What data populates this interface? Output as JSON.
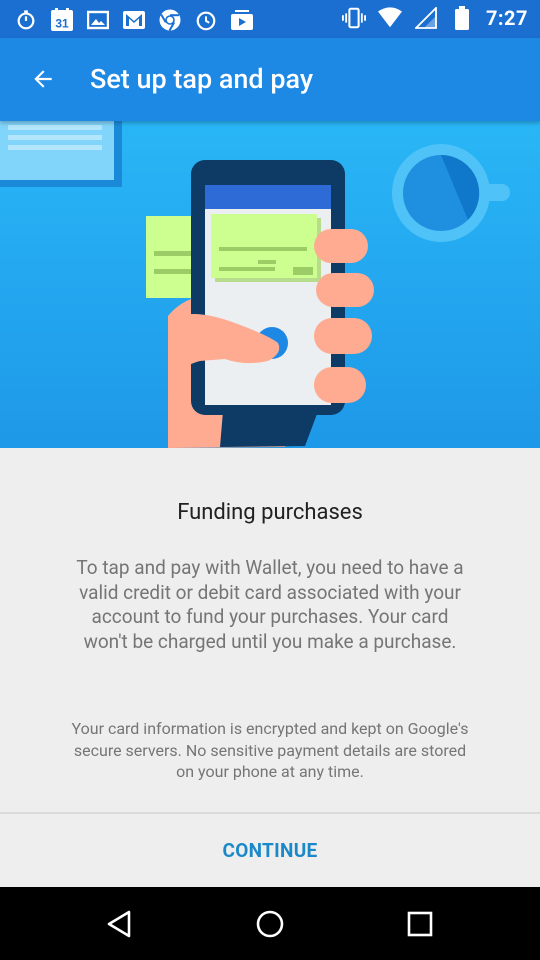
{
  "status_bar": {
    "time": "7:27",
    "calendar_date": "31",
    "left_icons": [
      "stopwatch-icon",
      "calendar-icon",
      "image-icon",
      "gmail-icon",
      "chrome-icon",
      "alarm-icon",
      "photos-icon"
    ],
    "right_icons": [
      "vibrate-icon",
      "wifi-icon",
      "signal-icon",
      "battery-icon"
    ]
  },
  "app_bar": {
    "title": "Set up tap and pay",
    "back_icon": "arrow-back-icon",
    "color": "#1e88e5"
  },
  "content": {
    "heading": "Funding purchases",
    "body": "To tap and pay with Wallet, you need to have a valid credit or debit card associated with your account to fund your purchases. Your card won't be charged until you make a purchase.",
    "fine_print": "Your card information is encrypted and kept on Google's secure servers. No sensitive payment details are stored on your phone at any time."
  },
  "actions": {
    "continue_label": "CONTINUE",
    "accent_color": "#1a88c9"
  },
  "nav_bar": {
    "back": "nav-back-icon",
    "home": "nav-home-icon",
    "recents": "nav-recents-icon"
  }
}
